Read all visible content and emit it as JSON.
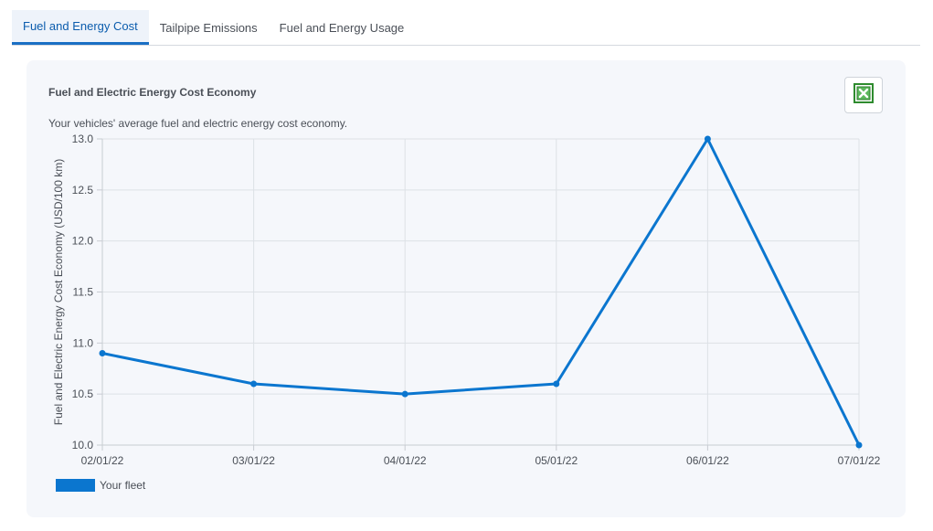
{
  "tabs": [
    {
      "label": "Fuel and Energy Cost",
      "active": true
    },
    {
      "label": "Tailpipe Emissions",
      "active": false
    },
    {
      "label": "Fuel and Energy Usage",
      "active": false
    }
  ],
  "card": {
    "title": "Fuel and Electric Energy Cost Economy",
    "subtitle": "Your vehicles' average fuel and electric energy cost economy.",
    "export_icon": "excel-icon"
  },
  "colors": {
    "series": "#0b76cf",
    "grid": "#dde1e6",
    "axis_text": "#4a4f57",
    "active_tab": "#1a6fc4",
    "excel_green": "#2e8b2e"
  },
  "chart_data": {
    "type": "line",
    "title": "",
    "xlabel": "",
    "ylabel": "Fuel and Electric Energy Cost Economy (USD/100 km)",
    "categories": [
      "02/01/22",
      "03/01/22",
      "04/01/22",
      "05/01/22",
      "06/01/22",
      "07/01/22"
    ],
    "ylim": [
      10.0,
      13.0
    ],
    "yticks": [
      "13.0",
      "12.5",
      "12.0",
      "11.5",
      "11.0",
      "10.5",
      "10.0"
    ],
    "grid": true,
    "legend_position": "bottom-left",
    "series": [
      {
        "name": "Your fleet",
        "values": [
          10.9,
          10.6,
          10.5,
          10.6,
          13.0,
          10.0
        ]
      }
    ]
  }
}
